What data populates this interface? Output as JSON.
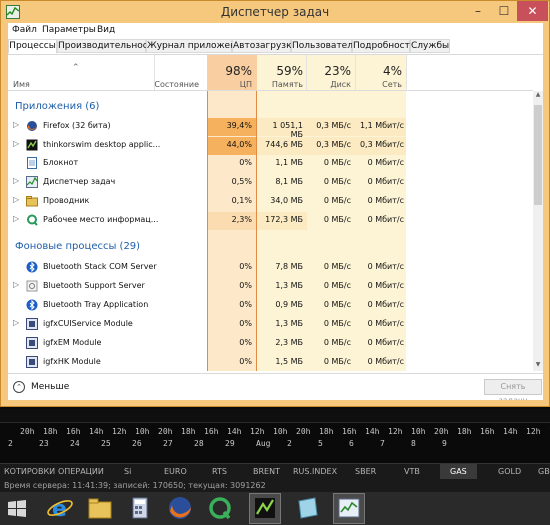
{
  "window": {
    "title": "Диспетчер задач",
    "min_glyph": "–",
    "max_glyph": "☐",
    "close_glyph": "✕"
  },
  "menu": [
    "Файл",
    "Параметры",
    "Вид"
  ],
  "tabs": [
    "Процессы",
    "Производительность",
    "Журнал приложений",
    "Автозагрузка",
    "Пользователи",
    "Подробности",
    "Службы"
  ],
  "header": {
    "name": "Имя",
    "state": "Состояние",
    "cpu_pct": "98%",
    "cpu_lbl": "ЦП",
    "mem_pct": "59%",
    "mem_lbl": "Память",
    "disk_pct": "23%",
    "disk_lbl": "Диск",
    "net_pct": "4%",
    "net_lbl": "Сеть"
  },
  "groups": {
    "apps": "Приложения (6)",
    "background": "Фоновые процессы (29)"
  },
  "apps": [
    {
      "name": "Firefox (32 бита)",
      "cpu": "39,4%",
      "mem": "1 051,1 МБ",
      "disk": "0,3 МБ/с",
      "net": "1,1 Мбит/с",
      "icon": "firefox-icon"
    },
    {
      "name": "thinkorswim desktop applic...",
      "cpu": "44,0%",
      "mem": "744,6 МБ",
      "disk": "0,3 МБ/с",
      "net": "0,3 Мбит/с",
      "icon": "thinkorswim-icon"
    },
    {
      "name": "Блокнот",
      "cpu": "0%",
      "mem": "1,1 МБ",
      "disk": "0 МБ/с",
      "net": "0 Мбит/с",
      "icon": "notepad-icon"
    },
    {
      "name": "Диспетчер задач",
      "cpu": "0,5%",
      "mem": "8,1 МБ",
      "disk": "0 МБ/с",
      "net": "0 Мбит/с",
      "icon": "task-manager-icon"
    },
    {
      "name": "Проводник",
      "cpu": "0,1%",
      "mem": "34,0 МБ",
      "disk": "0 МБ/с",
      "net": "0 Мбит/с",
      "icon": "explorer-icon"
    },
    {
      "name": "Рабочее место информац...",
      "cpu": "2,3%",
      "mem": "172,3 МБ",
      "disk": "0 МБ/с",
      "net": "0 Мбит/с",
      "icon": "quik-icon"
    }
  ],
  "background": [
    {
      "name": "Bluetooth Stack COM Server",
      "cpu": "0%",
      "mem": "7,8 МБ",
      "disk": "0 МБ/с",
      "net": "0 Мбит/с",
      "icon": "bluetooth-icon"
    },
    {
      "name": "Bluetooth Support Server",
      "cpu": "0%",
      "mem": "1,3 МБ",
      "disk": "0 МБ/с",
      "net": "0 Мбит/с",
      "icon": "service-icon"
    },
    {
      "name": "Bluetooth Tray Application",
      "cpu": "0%",
      "mem": "0,9 МБ",
      "disk": "0 МБ/с",
      "net": "0 Мбит/с",
      "icon": "bluetooth-icon"
    },
    {
      "name": "igfxCUIService Module",
      "cpu": "0%",
      "mem": "1,3 МБ",
      "disk": "0 МБ/с",
      "net": "0 Мбит/с",
      "icon": "igfx-icon"
    },
    {
      "name": "igfxEM Module",
      "cpu": "0%",
      "mem": "2,3 МБ",
      "disk": "0 МБ/с",
      "net": "0 Мбит/с",
      "icon": "igfx-icon"
    },
    {
      "name": "igfxHK Module",
      "cpu": "0%",
      "mem": "1,5 МБ",
      "disk": "0 МБ/с",
      "net": "0 Мбит/с",
      "icon": "igfx-icon"
    }
  ],
  "footer": {
    "fewer": "Меньше",
    "end_task": "Снять задачу"
  },
  "timeline": {
    "hours": [
      "20h",
      "18h",
      "16h",
      "14h",
      "12h",
      "10h",
      "20h",
      "18h",
      "16h",
      "14h",
      "12h",
      "10h",
      "20h",
      "18h",
      "16h",
      "14h",
      "12h",
      "10h",
      "20h",
      "18h",
      "16h",
      "14h",
      "12h",
      "10h"
    ],
    "days": [
      "2",
      "23",
      "24",
      "25",
      "26",
      "27",
      "28",
      "29",
      "Aug",
      "2",
      "5",
      "6",
      "7",
      "8",
      "9"
    ]
  },
  "instruments": [
    "КОТИРОВКИ",
    "ОПЕРАЦИИ",
    "Si",
    "EURO",
    "RTS",
    "BRENT",
    "RUS.INDEX",
    "SBER",
    "VTB",
    "GAS",
    "GOLD",
    "GBP"
  ],
  "selected_instrument": "GAS",
  "status": "Время сервера: 11:41:39; записей: 170650; текущая: 3091262",
  "taskbar": [
    "ie-icon",
    "explorer-icon",
    "calculator-icon",
    "firefox-icon",
    "quik-icon",
    "thinkorswim-icon",
    "notes-icon",
    "task-manager-icon"
  ],
  "colors": {
    "cpu_col": "#f6c78b",
    "cpu_hot": "#f5b15d",
    "col_light": "#fdf4d6",
    "col_mid": "#fbeac2",
    "accent": "#1e5ea8"
  }
}
